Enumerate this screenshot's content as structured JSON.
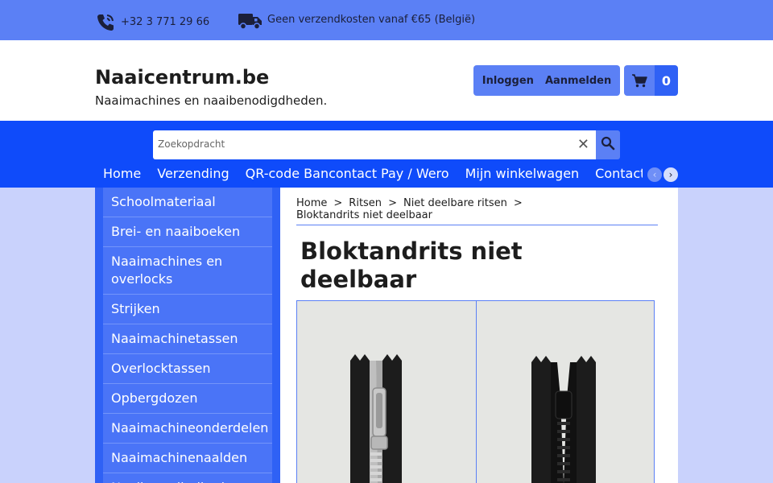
{
  "topbar": {
    "phone": "+32 3 771 29 66",
    "shipping": "Geen verzendkosten vanaf €65 (België)",
    "phone_icon": "phone-icon",
    "truck_icon": "truck-icon"
  },
  "header": {
    "title": "Naaicentrum.be",
    "subtitle": "Naaimachines en naaibenodigdheden.",
    "login_label": "Inloggen",
    "register_label": "Aanmelden",
    "cart_icon": "cart-icon",
    "cart_count": "0"
  },
  "search": {
    "placeholder": "Zoekopdracht",
    "clear": "✕"
  },
  "menu": {
    "items": [
      "Home",
      "Verzending",
      "QR-code Bancontact Pay / Wero",
      "Mijn winkelwagen",
      "Contact"
    ],
    "prev": "‹",
    "next": "›"
  },
  "sidebar": {
    "items": [
      "Schoolmateriaal",
      "Brei- en naaiboeken",
      "Naaimachines en overlocks",
      "Strijken",
      "Naaimachinetassen",
      "Overlocktassen",
      "Opbergdozen",
      "Naaimachineonderdelen",
      "Naaimachinenaalden",
      "Naaibenodigdheden"
    ]
  },
  "breadcrumb": {
    "items": [
      "Home",
      "Ritsen",
      "Niet deelbare ritsen",
      "Bloktandrits niet deelbaar"
    ],
    "separator": ">"
  },
  "page": {
    "title": "Bloktandrits niet deelbaar"
  },
  "colors": {
    "topbar": "#5b80f5",
    "navband": "#0f4bfa",
    "sidebar": "#4a74f7",
    "background": "#c9d2fc"
  }
}
